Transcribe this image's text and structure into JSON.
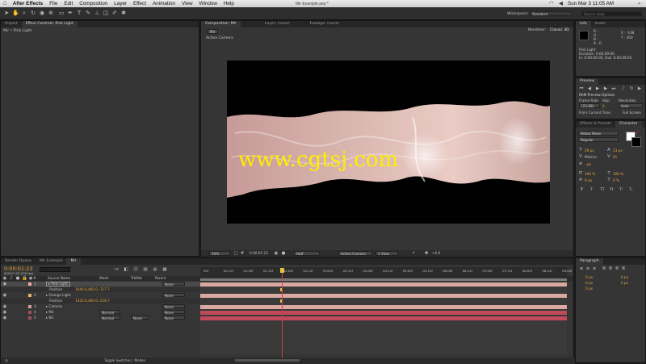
{
  "menubar": {
    "app": "After Effects",
    "items": [
      "File",
      "Edit",
      "Composition",
      "Layer",
      "Effect",
      "Animation",
      "View",
      "Window",
      "Help"
    ],
    "title": "Mir Example.aep *",
    "clock": "Sun Mar 3  11:05 AM"
  },
  "toolbar": {
    "workspace_label": "Workspace:",
    "workspace_value": "Standard",
    "search_placeholder": "Search Help"
  },
  "project": {
    "tabs": [
      "Project",
      "Effect Controls: Pink Light"
    ],
    "breadcrumb": "Mir • Pink Light"
  },
  "comp": {
    "tabs": [
      "Composition: Mir",
      "Layer: (none)",
      "Footage: (none)"
    ],
    "renderer_label": "Renderer:",
    "renderer_value": "Classic 3D",
    "chip": "Mir",
    "view_label": "Active Camera",
    "watermark": "www.cgtsj.com",
    "footer": {
      "zoom": "50%",
      "timecode": "0:00:01:23",
      "resolution": "Half",
      "camera": "Active Camera",
      "views": "1 View",
      "exposure": "+0.0"
    }
  },
  "info": {
    "tabs": [
      "Info",
      "Audio"
    ],
    "r": "R :",
    "g": "G :",
    "b": "B :",
    "a": "A : 0",
    "x": "X : -148",
    "y": "Y : 300",
    "layer_name": "Pink Light",
    "duration": "Duration: 0:00:09:06",
    "in_out": "In: 0:00:00:00, Out: 0:00:09:05"
  },
  "preview": {
    "tab": "Preview",
    "ram_options": "RAM Preview Options",
    "frame_rate_label": "Frame Rate",
    "skip_label": "Skip",
    "resolution_label": "Resolution",
    "frame_rate": "(23.98)",
    "skip": "0",
    "resolution": "Auto",
    "from_current": "From Current Time",
    "full_screen": "Full Screen"
  },
  "character": {
    "tabs": [
      "Effects & Presets",
      "Character"
    ],
    "font": "Bebas Neue",
    "style": "Regular",
    "size": "29 px",
    "leading": "23 px",
    "kerning": "Metrics",
    "tracking": "61",
    "stroke": "- px",
    "vscale": "100 %",
    "hscale": "100 %",
    "baseline": "0 px",
    "tsume": "0 %",
    "styles": [
      "T",
      "T",
      "TT",
      "Tt",
      "T¹",
      "T₁"
    ]
  },
  "paragraph": {
    "tab": "Paragraph",
    "indent_left": "0 px",
    "indent_right": "0 px",
    "indent_first": "0 px",
    "space_before": "0 px",
    "space_after": "0 px"
  },
  "timeline": {
    "tabs": [
      "Render Queue",
      "Mir Example",
      "Mir"
    ],
    "timecode": "0:00:01:23",
    "frames": "00047 (23.976 fps)",
    "columns": {
      "source": "Source Name",
      "mode": "Mode",
      "trkmat": "TrkMat",
      "parent": "Parent"
    },
    "ruler": [
      "00f",
      "00:12f",
      "01:00f",
      "01:12f",
      "02:00f",
      "02:12f",
      "03:00f",
      "03:12f",
      "04:00f",
      "04:12f",
      "05:00f",
      "05:12f",
      "06:00f",
      "06:12f",
      "07:00f",
      "07:12f",
      "08:00f",
      "08:12f",
      "09:00f"
    ],
    "layers": [
      {
        "num": "1",
        "name": "Pink Light",
        "mode": "",
        "trkmat": "",
        "parent_val": "None",
        "color": "#f0a8a8",
        "selected": true
      },
      {
        "num": "",
        "name": "Position",
        "mode": "",
        "trkmat": "",
        "parent_val": "",
        "value": "1040.0,460.0,-717.7",
        "sub": true
      },
      {
        "num": "2",
        "name": "Orange Light",
        "mode": "",
        "trkmat": "",
        "parent_val": "None",
        "color": "#e8b070"
      },
      {
        "num": "",
        "name": "Position",
        "mode": "",
        "trkmat": "",
        "parent_val": "",
        "value": "1320.0,460.0,-218.7",
        "sub": true
      },
      {
        "num": "3",
        "name": "Camera",
        "mode": "",
        "trkmat": "",
        "parent_val": "None",
        "color": "#d0a0a0"
      },
      {
        "num": "4",
        "name": "Mir",
        "mode": "Normal",
        "trkmat": "",
        "parent_val": "None",
        "color": "#a05060"
      },
      {
        "num": "5",
        "name": "BG",
        "mode": "Normal",
        "trkmat": "None",
        "parent_val": "None",
        "color": "#a05060"
      }
    ],
    "toggle_label": "Toggle Switches / Modes"
  },
  "colors": {
    "panel": "#353535",
    "accent": "#f0a000",
    "playhead": "#d04040",
    "track_pink": "#d9a8a0",
    "track_red": "#c04a5a"
  }
}
